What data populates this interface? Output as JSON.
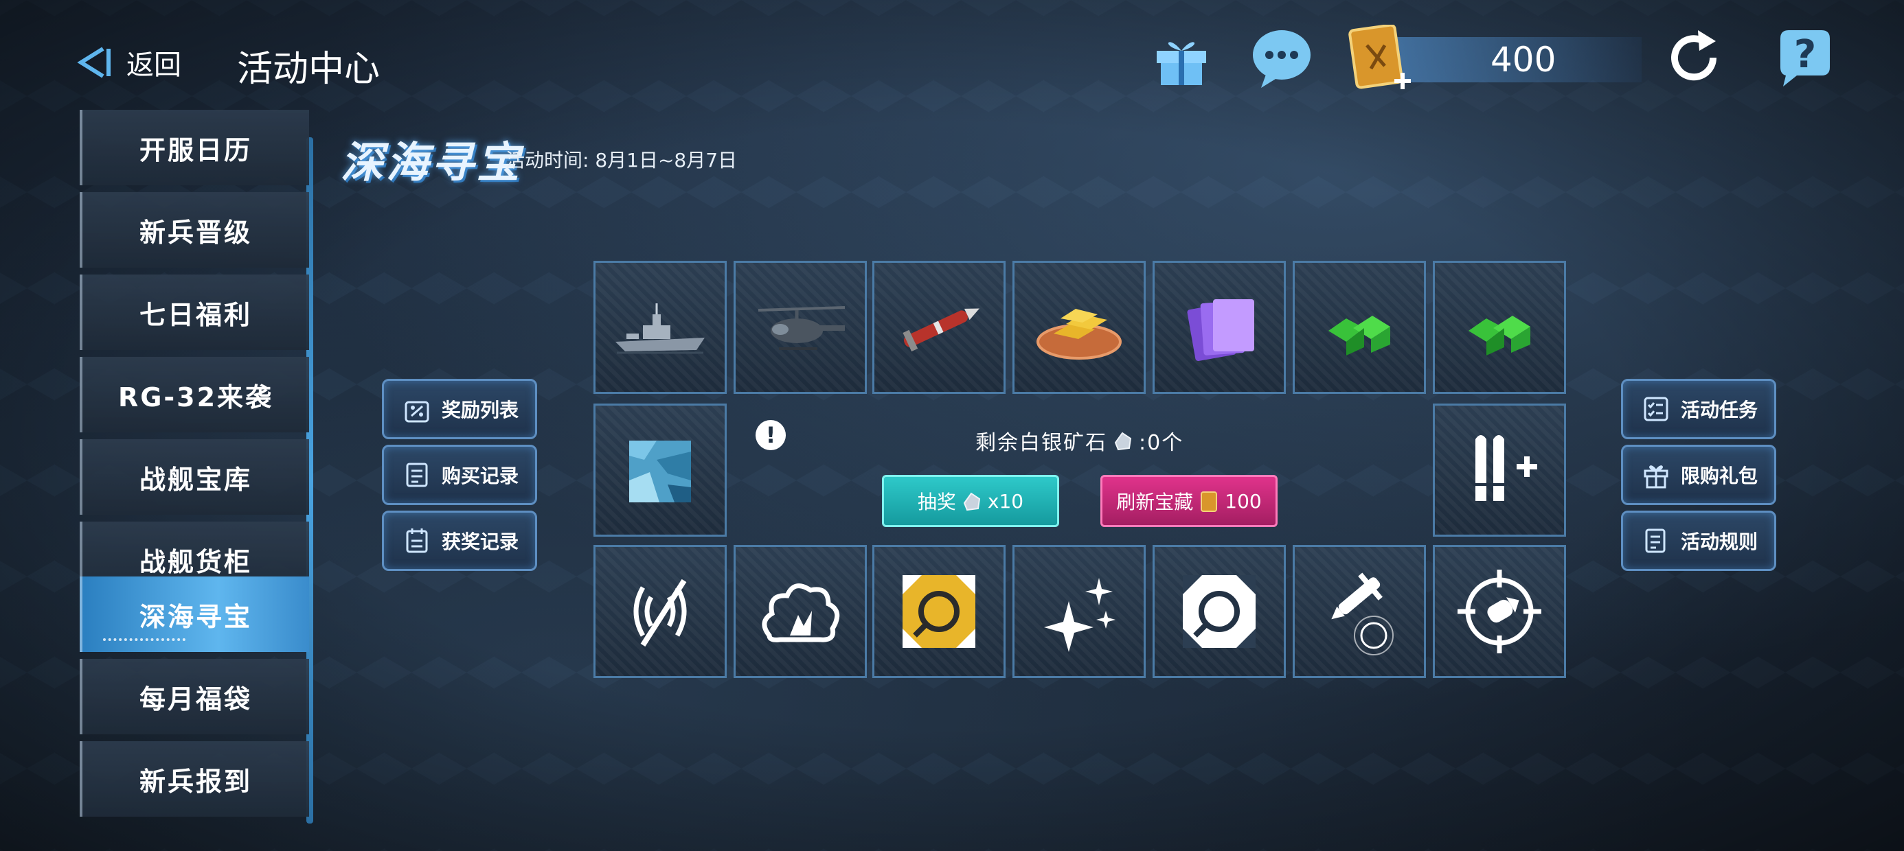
{
  "header": {
    "back_label": "返回",
    "title": "活动中心",
    "currency_value": "400"
  },
  "sidebar": {
    "items": [
      {
        "label": "开服日历"
      },
      {
        "label": "新兵晋级"
      },
      {
        "label": "七日福利"
      },
      {
        "label": "RG-32来袭"
      },
      {
        "label": "战舰宝库"
      },
      {
        "label": "战舰货柜"
      },
      {
        "label": "深海寻宝"
      },
      {
        "label": "每月福袋"
      },
      {
        "label": "新兵报到"
      }
    ],
    "active_index": 6
  },
  "event": {
    "title": "深海寻宝",
    "time": "活动时间: 8月1日~8月7日"
  },
  "left_buttons": [
    {
      "label": "奖励列表",
      "icon": "discount-box-icon"
    },
    {
      "label": "购买记录",
      "icon": "receipt-icon"
    },
    {
      "label": "获奖记录",
      "icon": "calendar-list-icon"
    }
  ],
  "right_buttons": [
    {
      "label": "活动任务",
      "icon": "task-list-icon"
    },
    {
      "label": "限购礼包",
      "icon": "gift-icon"
    },
    {
      "label": "活动规则",
      "icon": "document-icon"
    }
  ],
  "center": {
    "remaining_label": "剩余白银矿石",
    "remaining_value": ":0个",
    "draw_label": "抽奖",
    "draw_count": "x10",
    "refresh_label": "刷新宝藏",
    "refresh_cost": "100"
  },
  "grid": {
    "row1": [
      "warship-icon",
      "helicopter-icon",
      "missile-icon",
      "gold-bars-icon",
      "purple-cards-icon",
      "green-crystal-icon",
      "green-crystal-icon"
    ],
    "row2_left": "camo-skin-icon",
    "row2_right": "ammo-plus-icon",
    "row3": [
      "jammer-icon",
      "explosion-icon",
      "repair-gold-icon",
      "sparkle-icon",
      "repair-icon",
      "missile-strike-icon",
      "target-icon"
    ]
  },
  "colors": {
    "accent_blue": "#4aa3e0",
    "draw_teal": "#2ec9c9",
    "refresh_pink": "#e0338b"
  }
}
